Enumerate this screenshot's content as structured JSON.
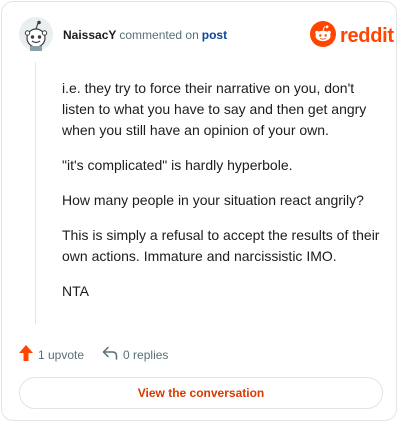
{
  "header": {
    "username": "NaissacY",
    "action_text": "commented on",
    "post_link": "post"
  },
  "logo": {
    "text": "reddit",
    "brand_color": "#ff4500"
  },
  "comment": {
    "paragraphs": [
      "i.e. they try to force their narrative on you, don't listen to what you have to say and then get angry when you still have an opinion of your own.",
      "\"it's complicated\" is hardly hyperbole.",
      "How many people in your situation react angrily?",
      "This is simply a refusal to accept the results of their own actions. Immature and narcissistic IMO.",
      "NTA"
    ]
  },
  "actions": {
    "upvote_label": "1 upvote",
    "replies_label": "0 replies"
  },
  "view_button": {
    "label": "View the conversation"
  },
  "icons": {
    "avatar": "snoo-avatar-icon",
    "logo": "reddit-logo-icon",
    "upvote": "upvote-arrow-icon",
    "reply": "reply-arrow-icon"
  },
  "colors": {
    "link": "#0a449b",
    "meta": "#576f76",
    "accent": "#d93900",
    "upvote": "#ff4500"
  }
}
